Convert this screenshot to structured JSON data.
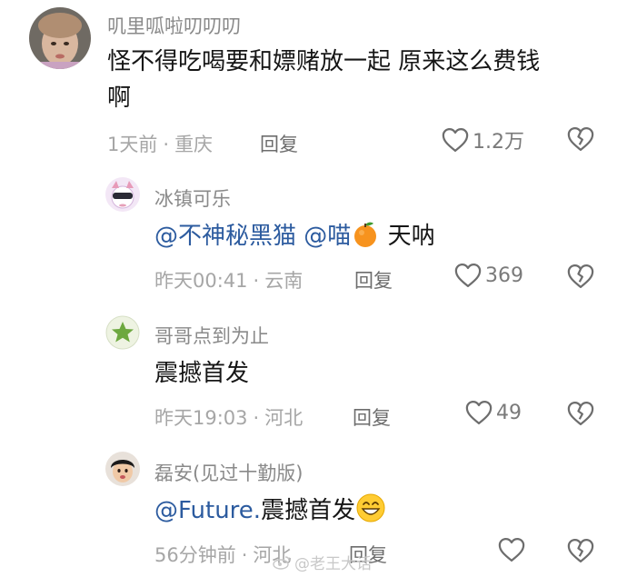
{
  "comments": [
    {
      "username": "叽里呱啦叨叨叨",
      "line1": "怪不得吃喝要和嫖赌放一起 原来这么费钱",
      "line2": "啊",
      "time": "1天前",
      "location": "重庆",
      "reply_label": "回复",
      "likes": "1.2万"
    },
    {
      "username": "冰镇可乐",
      "mention1": "@不神秘黑猫",
      "mention2": "@喵",
      "emoji": "orange",
      "text": "天呐",
      "time": "昨天00:41",
      "location": "云南",
      "reply_label": "回复",
      "likes": "369"
    },
    {
      "username": "哥哥点到为止",
      "text": "震撼首发",
      "time": "昨天19:03",
      "location": "河北",
      "reply_label": "回复",
      "likes": "49"
    },
    {
      "username": "磊安(见过十勤版)",
      "mention": "@Future.",
      "text": "震撼首发",
      "emoji": "grinning-face",
      "time": "56分钟前",
      "location": "河北",
      "reply_label": "回复",
      "likes": ""
    }
  ],
  "watermark": "@老王大话",
  "colors": {
    "mention": "#2c5b9f",
    "username": "#8a8a8a",
    "meta": "#a6a6a6"
  }
}
